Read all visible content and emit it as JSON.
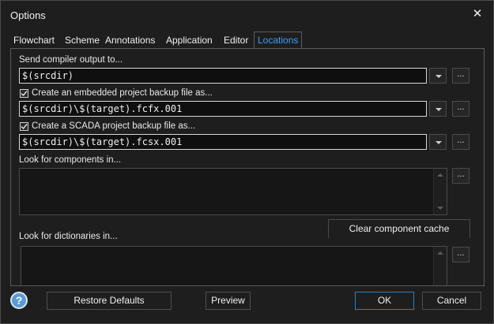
{
  "window": {
    "title": "Options",
    "close_glyph": "✕"
  },
  "tabs": [
    {
      "label": "Flowchart",
      "active": false
    },
    {
      "label": "Scheme",
      "active": false
    },
    {
      "label": "Annotations",
      "active": false
    },
    {
      "label": "Application",
      "active": false
    },
    {
      "label": "Editor",
      "active": false
    },
    {
      "label": "Locations",
      "active": true
    }
  ],
  "locations": {
    "compiler_output": {
      "label": "Send compiler output to...",
      "value": "$(srcdir)"
    },
    "embedded_backup": {
      "label": "Create an embedded project backup file as...",
      "checked": true,
      "value": "$(srcdir)\\$(target).fcfx.001"
    },
    "scada_backup": {
      "label": "Create a SCADA project backup file as...",
      "checked": true,
      "value": "$(srcdir)\\$(target).fcsx.001"
    },
    "components": {
      "label": "Look for components in..."
    },
    "clear_cache_label": "Clear component cache",
    "dictionaries": {
      "label": "Look for dictionaries in..."
    },
    "browse_label": "..."
  },
  "footer": {
    "help_glyph": "?",
    "restore_label": "Restore Defaults",
    "preview_label": "Preview",
    "ok_label": "OK",
    "cancel_label": "Cancel"
  },
  "colors": {
    "accent": "#35a0ff",
    "background": "#1e1e1e",
    "ok_border": "#2e7fc0"
  },
  "icons": [
    "close-icon",
    "dropdown-arrow-icon",
    "checkbox-check-icon",
    "help-icon",
    "scroll-up-icon",
    "scroll-down-icon"
  ]
}
